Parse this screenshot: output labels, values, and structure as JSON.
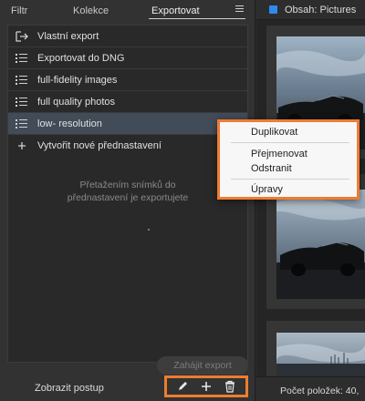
{
  "tabs": [
    {
      "label": "Filtr"
    },
    {
      "label": "Kolekce"
    },
    {
      "label": "Exportovat"
    }
  ],
  "presets": [
    {
      "label": "Vlastní export",
      "icon": "export-icon"
    },
    {
      "label": "Exportovat do DNG",
      "icon": "list-icon"
    },
    {
      "label": "full-fidelity images",
      "icon": "list-icon"
    },
    {
      "label": "full quality photos",
      "icon": "list-icon"
    },
    {
      "label": "low- resolution",
      "icon": "list-icon",
      "selected": true
    }
  ],
  "new_preset_label": "Vytvořit nové přednastavení",
  "hint_line1": "Přetažením snímků do",
  "hint_line2": "přednastavení je exportujete",
  "start_export_label": "Zahájit export",
  "show_progress_label": "Zobrazit postup",
  "content_title": "Obsah: Pictures",
  "status_text": "Počet položek: 40,",
  "context_menu": {
    "duplicate": "Duplikovat",
    "rename": "Přejmenovat",
    "remove": "Odstranit",
    "edit": "Úpravy"
  },
  "colors": {
    "accent": "#2d8ceb",
    "highlight": "#ed7d31",
    "selected": "#424b58"
  }
}
